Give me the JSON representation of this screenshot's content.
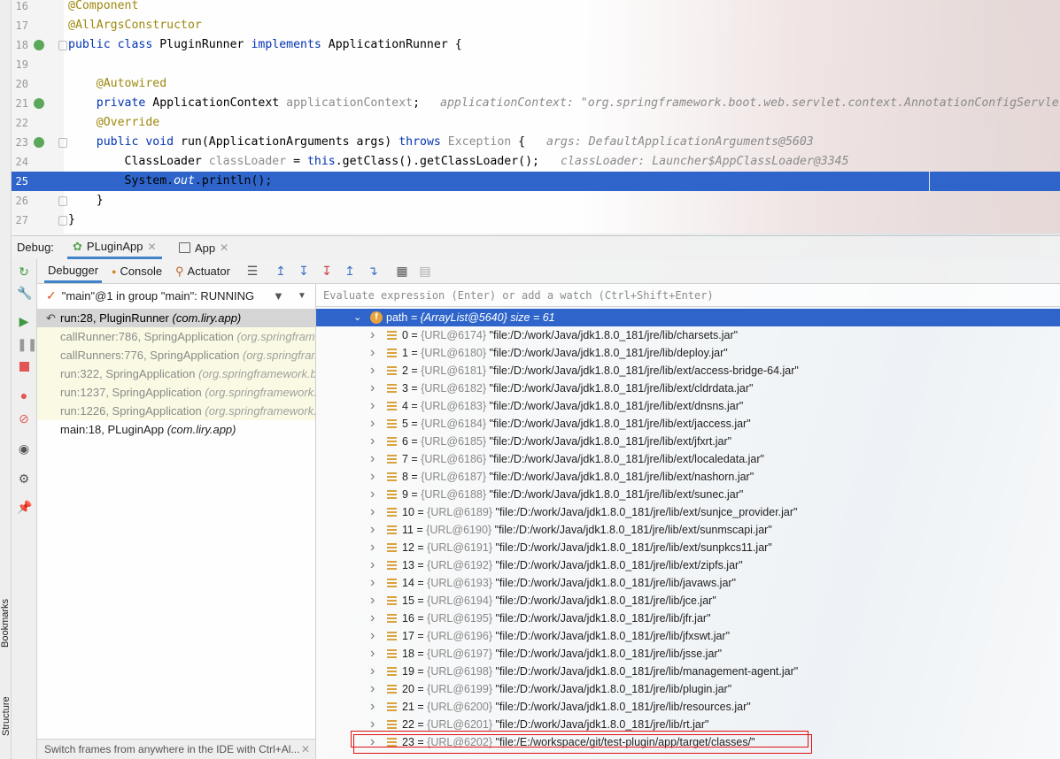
{
  "editor": {
    "lines": [
      {
        "num": "16",
        "parts": [
          [
            "an",
            "@Component"
          ]
        ]
      },
      {
        "num": "17",
        "parts": [
          [
            "an",
            "@AllArgsConstructor"
          ]
        ]
      },
      {
        "num": "18",
        "parts": [
          [
            "kw",
            "public "
          ],
          [
            "kw",
            "class "
          ],
          [
            "cl",
            "PluginRunner "
          ],
          [
            "kw",
            "implements "
          ],
          [
            "cl",
            "ApplicationRunner {"
          ]
        ]
      },
      {
        "num": "19",
        "parts": []
      },
      {
        "num": "20",
        "parts": [
          [
            "cl",
            "    "
          ],
          [
            "an",
            "@Autowired"
          ]
        ]
      },
      {
        "num": "21",
        "parts": [
          [
            "cl",
            "    "
          ],
          [
            "kw",
            "private "
          ],
          [
            "cl",
            "ApplicationContext "
          ],
          [
            "gray",
            "applicationContext"
          ],
          [
            "cl",
            ";"
          ]
        ],
        "hint": "applicationContext: \"org.springframework.boot.web.servlet.context.AnnotationConfigServle"
      },
      {
        "num": "22",
        "parts": [
          [
            "cl",
            "    "
          ],
          [
            "an",
            "@Override"
          ]
        ]
      },
      {
        "num": "23",
        "parts": [
          [
            "cl",
            "    "
          ],
          [
            "kw",
            "public "
          ],
          [
            "kw",
            "void "
          ],
          [
            "cl",
            "run(ApplicationArguments args) "
          ],
          [
            "kw",
            "throws "
          ],
          [
            "gray",
            "Exception "
          ],
          [
            "cl",
            "{"
          ]
        ],
        "hint": "args: DefaultApplicationArguments@5603"
      },
      {
        "num": "24",
        "parts": [
          [
            "cl",
            "        ClassLoader "
          ],
          [
            "gray",
            "classLoader "
          ],
          [
            "cl",
            "= "
          ],
          [
            "kw",
            "this"
          ],
          [
            "cl",
            ".getClass().getClassLoader();"
          ]
        ],
        "hint": "classLoader: Launcher$AppClassLoader@3345"
      },
      {
        "num": "25",
        "parts": [
          [
            "cl",
            "        System."
          ],
          [
            "fld ital",
            "out"
          ],
          [
            "cl",
            ".println();"
          ]
        ]
      },
      {
        "num": "26",
        "parts": [
          [
            "cl",
            "    }"
          ]
        ]
      },
      {
        "num": "27",
        "parts": [
          [
            "cl",
            "}"
          ]
        ]
      }
    ]
  },
  "debug": {
    "title": "Debug:",
    "tabs": [
      {
        "label": "PLuginApp"
      },
      {
        "label": "App"
      }
    ],
    "toolbar_tabs": {
      "debugger": "Debugger",
      "console": "Console",
      "actuator": "Actuator"
    },
    "thread": "\"main\"@1 in group \"main\": RUNNING",
    "frames": [
      {
        "method": "run:28, PluginRunner",
        "pkg": "(com.liry.app)",
        "kind": "current"
      },
      {
        "method": "callRunner:786, SpringApplication",
        "pkg": "(org.springframework.boot)",
        "kind": "lib"
      },
      {
        "method": "callRunners:776, SpringApplication",
        "pkg": "(org.springframework.boot)",
        "kind": "lib"
      },
      {
        "method": "run:322, SpringApplication",
        "pkg": "(org.springframework.boot)",
        "kind": "lib"
      },
      {
        "method": "run:1237, SpringApplication",
        "pkg": "(org.springframework.boot)",
        "kind": "lib"
      },
      {
        "method": "run:1226, SpringApplication",
        "pkg": "(org.springframework.boot)",
        "kind": "lib"
      },
      {
        "method": "main:18, PLuginApp",
        "pkg": "(com.liry.app)",
        "kind": "normal"
      }
    ],
    "frames_status": "Switch frames from anywhere in the IDE with Ctrl+Al...",
    "eval_placeholder": "Evaluate expression (Enter) or add a watch (Ctrl+Shift+Enter)",
    "path_var": {
      "name": "path",
      "value": "= {ArrayList@5640}  size = 61"
    },
    "path_items": [
      {
        "idx": "0",
        "id": "{URL@6174}",
        "val": "\"file:/D:/work/Java/jdk1.8.0_181/jre/lib/charsets.jar\""
      },
      {
        "idx": "1",
        "id": "{URL@6180}",
        "val": "\"file:/D:/work/Java/jdk1.8.0_181/jre/lib/deploy.jar\""
      },
      {
        "idx": "2",
        "id": "{URL@6181}",
        "val": "\"file:/D:/work/Java/jdk1.8.0_181/jre/lib/ext/access-bridge-64.jar\""
      },
      {
        "idx": "3",
        "id": "{URL@6182}",
        "val": "\"file:/D:/work/Java/jdk1.8.0_181/jre/lib/ext/cldrdata.jar\""
      },
      {
        "idx": "4",
        "id": "{URL@6183}",
        "val": "\"file:/D:/work/Java/jdk1.8.0_181/jre/lib/ext/dnsns.jar\""
      },
      {
        "idx": "5",
        "id": "{URL@6184}",
        "val": "\"file:/D:/work/Java/jdk1.8.0_181/jre/lib/ext/jaccess.jar\""
      },
      {
        "idx": "6",
        "id": "{URL@6185}",
        "val": "\"file:/D:/work/Java/jdk1.8.0_181/jre/lib/ext/jfxrt.jar\""
      },
      {
        "idx": "7",
        "id": "{URL@6186}",
        "val": "\"file:/D:/work/Java/jdk1.8.0_181/jre/lib/ext/localedata.jar\""
      },
      {
        "idx": "8",
        "id": "{URL@6187}",
        "val": "\"file:/D:/work/Java/jdk1.8.0_181/jre/lib/ext/nashorn.jar\""
      },
      {
        "idx": "9",
        "id": "{URL@6188}",
        "val": "\"file:/D:/work/Java/jdk1.8.0_181/jre/lib/ext/sunec.jar\""
      },
      {
        "idx": "10",
        "id": "{URL@6189}",
        "val": "\"file:/D:/work/Java/jdk1.8.0_181/jre/lib/ext/sunjce_provider.jar\""
      },
      {
        "idx": "11",
        "id": "{URL@6190}",
        "val": "\"file:/D:/work/Java/jdk1.8.0_181/jre/lib/ext/sunmscapi.jar\""
      },
      {
        "idx": "12",
        "id": "{URL@6191}",
        "val": "\"file:/D:/work/Java/jdk1.8.0_181/jre/lib/ext/sunpkcs11.jar\""
      },
      {
        "idx": "13",
        "id": "{URL@6192}",
        "val": "\"file:/D:/work/Java/jdk1.8.0_181/jre/lib/ext/zipfs.jar\""
      },
      {
        "idx": "14",
        "id": "{URL@6193}",
        "val": "\"file:/D:/work/Java/jdk1.8.0_181/jre/lib/javaws.jar\""
      },
      {
        "idx": "15",
        "id": "{URL@6194}",
        "val": "\"file:/D:/work/Java/jdk1.8.0_181/jre/lib/jce.jar\""
      },
      {
        "idx": "16",
        "id": "{URL@6195}",
        "val": "\"file:/D:/work/Java/jdk1.8.0_181/jre/lib/jfr.jar\""
      },
      {
        "idx": "17",
        "id": "{URL@6196}",
        "val": "\"file:/D:/work/Java/jdk1.8.0_181/jre/lib/jfxswt.jar\""
      },
      {
        "idx": "18",
        "id": "{URL@6197}",
        "val": "\"file:/D:/work/Java/jdk1.8.0_181/jre/lib/jsse.jar\""
      },
      {
        "idx": "19",
        "id": "{URL@6198}",
        "val": "\"file:/D:/work/Java/jdk1.8.0_181/jre/lib/management-agent.jar\""
      },
      {
        "idx": "20",
        "id": "{URL@6199}",
        "val": "\"file:/D:/work/Java/jdk1.8.0_181/jre/lib/plugin.jar\""
      },
      {
        "idx": "21",
        "id": "{URL@6200}",
        "val": "\"file:/D:/work/Java/jdk1.8.0_181/jre/lib/resources.jar\""
      },
      {
        "idx": "22",
        "id": "{URL@6201}",
        "val": "\"file:/D:/work/Java/jdk1.8.0_181/jre/lib/rt.jar\""
      },
      {
        "idx": "23",
        "id": "{URL@6202}",
        "val": "\"file:/E:/workspace/git/test-plugin/app/target/classes/\""
      }
    ]
  },
  "side_labels": {
    "bookmarks": "Bookmarks",
    "structure": "Structure"
  },
  "colors": {
    "selection": "#2f65ca",
    "annotation": "#9e880d",
    "keyword": "#0033b3",
    "highlight_box": "#e01010"
  }
}
